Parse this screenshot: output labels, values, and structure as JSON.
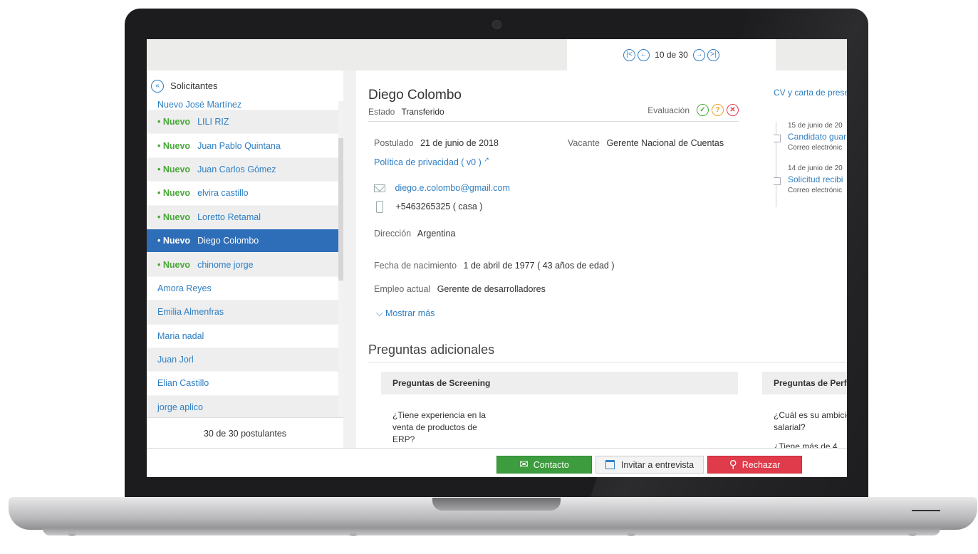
{
  "pager": {
    "text": "10 de 30"
  },
  "sidebar": {
    "title": "Solicitantes",
    "items": [
      {
        "new": "",
        "name": "Nuevo  José Martínez",
        "cut": true
      },
      {
        "new": "• Nuevo",
        "name": "LILI RIZ"
      },
      {
        "new": "• Nuevo",
        "name": "Juan Pablo Quintana"
      },
      {
        "new": "• Nuevo",
        "name": "Juan Carlos Gómez"
      },
      {
        "new": "• Nuevo",
        "name": "elvira castillo"
      },
      {
        "new": "• Nuevo",
        "name": "Loretto Retamal"
      },
      {
        "new": "• Nuevo",
        "name": "Diego Colombo",
        "active": true
      },
      {
        "new": "• Nuevo",
        "name": "chinome jorge"
      },
      {
        "new": "",
        "name": "Amora Reyes"
      },
      {
        "new": "",
        "name": "Emilia Almenfras"
      },
      {
        "new": "",
        "name": "Maria nadal"
      },
      {
        "new": "",
        "name": "Juan Jorl"
      },
      {
        "new": "",
        "name": "Elian Castillo"
      },
      {
        "new": "",
        "name": "jorge aplico"
      }
    ],
    "footer": "30 de 30 postulantes"
  },
  "candidate": {
    "name": "Diego Colombo",
    "state_label": "Estado",
    "state_value": "Transferido",
    "eval_label": "Evaluación",
    "applied_label": "Postulado",
    "applied_value": "21 de junio de 2018",
    "vacancy_label": "Vacante",
    "vacancy_value": "Gerente Nacional de Cuentas",
    "privacy_link": "Política de privacidad ( v0 )",
    "email": "diego.e.colombo@gmail.com",
    "phone": "+5463265325 ( casa )",
    "address_label": "Dirección",
    "address_value": "Argentina",
    "birth_label": "Fecha de nacimiento",
    "birth_value": "1 de abril de 1977 ( 43 años de edad )",
    "job_label": "Empleo actual",
    "job_value": "Gerente de desarrolladores",
    "show_more": "⌵ Mostrar más"
  },
  "questions": {
    "section_title": "Preguntas adicionales",
    "screening_header": "Preguntas de Screening",
    "screening_question": "¿Tiene experiencia en la venta de productos de ERP?",
    "profile_header": "Preguntas de Perf",
    "profile_question": "¿Cuál es su ambició salarial?",
    "profile_question_2": "¿Tiene más de 4"
  },
  "activity": {
    "cv_link": "CV y carta de prese",
    "items": [
      {
        "date": "15 de junio de 20",
        "title": "Candidato guar",
        "sub": "Correo electrónic"
      },
      {
        "date": "14 de junio de 20",
        "title": "Solicitud recibi",
        "sub": "Correo electrónic"
      }
    ]
  },
  "actions": {
    "contact": "Contacto",
    "invite": "Invitar a entrevista",
    "reject": "Rechazar"
  },
  "colors": {
    "primary": "#2f7fc4",
    "active_row": "#2e6db8",
    "new_badge": "#4aa83a",
    "contact_btn": "#3d9c3d",
    "reject_btn": "#e03b4a"
  },
  "icons": [
    "first-page-icon",
    "prev-icon",
    "next-icon",
    "last-page-icon",
    "collapse-icon",
    "check-icon",
    "question-icon",
    "close-icon",
    "mail-icon",
    "phone-icon",
    "calendar-icon",
    "reject-user-icon",
    "external-link-icon"
  ]
}
